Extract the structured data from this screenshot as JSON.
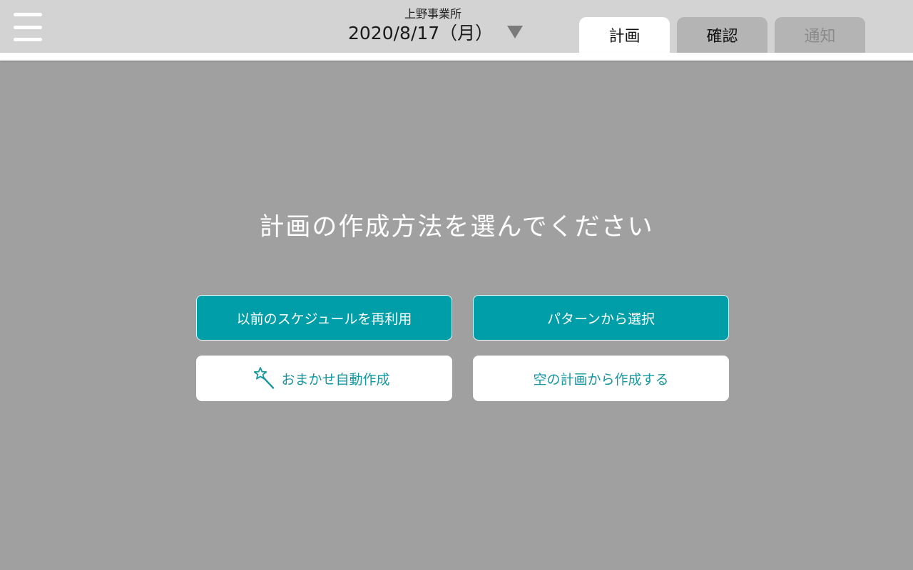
{
  "header": {
    "office_name": "上野事業所",
    "date": "2020/8/17（月）",
    "tabs": [
      {
        "label": "計画",
        "state": "active"
      },
      {
        "label": "確認",
        "state": "inactive"
      },
      {
        "label": "通知",
        "state": "disabled"
      }
    ]
  },
  "main": {
    "heading": "計画の作成方法を選んでください",
    "options": {
      "reuse_previous": "以前のスケジュールを再利用",
      "select_pattern": "パターンから選択",
      "auto_create": "おまかせ自動作成",
      "create_empty": "空の計画から作成する"
    }
  },
  "icons": {
    "menu": "hamburger-menu-icon",
    "date_dropdown": "caret-down-icon",
    "auto_create": "magic-wand-icon"
  },
  "colors": {
    "topbar": "#d3d3d3",
    "background": "#a0a0a0",
    "accent": "#009ea8",
    "accent_text": "#1798a1"
  }
}
